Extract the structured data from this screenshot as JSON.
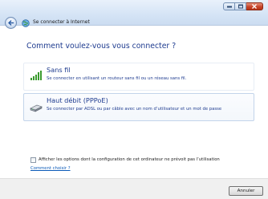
{
  "window": {
    "title": "Se connecter à Internet"
  },
  "heading": "Comment voulez-vous vous connecter ?",
  "options": [
    {
      "label": "Sans fil",
      "description": "Se connecter en utilisant un routeur sans fil ou un réseau sans fil.",
      "icon": "wireless-signal-icon"
    },
    {
      "label": "Haut débit (PPPoE)",
      "description": "Se connecter par ADSL ou par câble avec un nom d’utilisateur et un mot de passe",
      "icon": "broadband-modem-icon"
    }
  ],
  "checkbox": {
    "label": "Afficher les options dont la configuration de cet ordinateur ne prévoit pas l’utilisation",
    "checked": false
  },
  "help_link": "Comment choisir ?",
  "footer": {
    "cancel_label": "Annuler"
  }
}
